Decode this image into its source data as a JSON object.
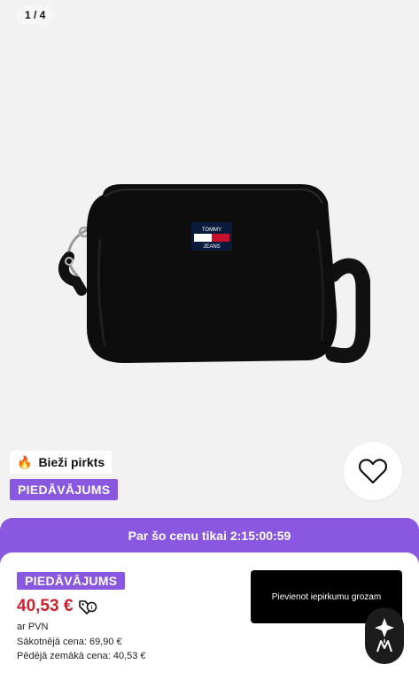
{
  "gallery": {
    "counter": "1 / 4",
    "image_alt": "Black Tommy Jeans crossbody camera bag"
  },
  "brand_patch": {
    "line1": "TOMMY",
    "line2": "JEANS"
  },
  "badges": {
    "bestseller": "Bieži pirkts",
    "offer": "PIEDĀVĀJUMS"
  },
  "promo": {
    "countdown_text": "Par šo cenu tikai 2:15:00:59"
  },
  "pricing": {
    "offer_badge": "PIEDĀVĀJUMS",
    "price": "40,53 €",
    "vat_note": "ar PVN",
    "original_price": "Sākotnējā cena: 69,90 €",
    "lowest_price": "Pēdējā zemākā cena:  40,53 €"
  },
  "actions": {
    "add_to_cart": "Pievienot iepirkumu grozam"
  },
  "icons": {
    "wishlist": "heart-outline-icon",
    "discount": "price-tag-percent-icon",
    "bestseller": "fire-icon",
    "assistant": "assistant-logo-icon"
  },
  "colors": {
    "accent_purple": "#8957e0",
    "price_red": "#d0202f",
    "button_black": "#000000"
  }
}
